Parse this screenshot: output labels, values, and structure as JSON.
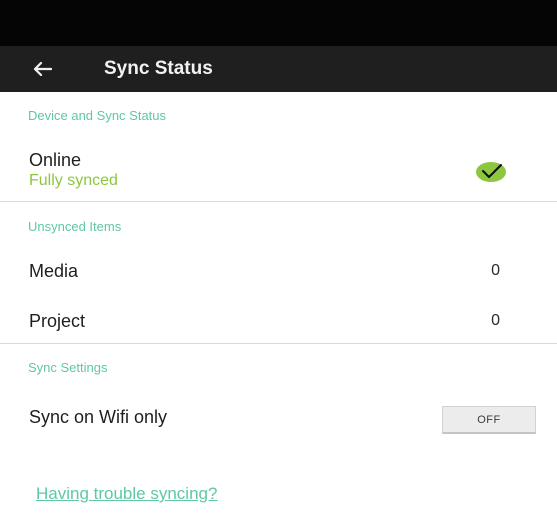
{
  "app_bar": {
    "title": "Sync Status",
    "back_icon": "arrow-left-icon"
  },
  "device_section": {
    "header": "Device and Sync Status",
    "status_label": "Online",
    "status_detail": "Fully synced",
    "status_icon": "checkmark-icon",
    "status_color": "#8dc63f"
  },
  "unsynced_section": {
    "header": "Unsynced Items",
    "items": [
      {
        "label": "Media",
        "count": "0"
      },
      {
        "label": "Project",
        "count": "0"
      }
    ]
  },
  "settings_section": {
    "header": "Sync Settings",
    "wifi_only_label": "Sync on Wifi only",
    "wifi_only_toggle": "OFF"
  },
  "help_link": "Having trouble syncing?",
  "colors": {
    "accent": "#5fc7a8",
    "app_bar": "#1f1f1f",
    "status_bar": "#050505"
  }
}
